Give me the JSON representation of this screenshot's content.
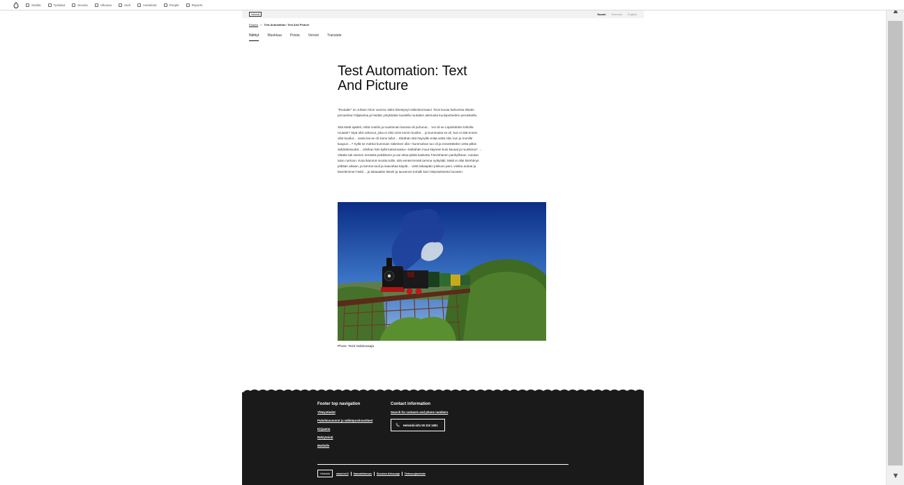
{
  "toolbar": {
    "items": [
      {
        "label": "Sisältö",
        "icon": "content-icon"
      },
      {
        "label": "Työkalut",
        "icon": "tools-icon"
      },
      {
        "label": "Sivusto",
        "icon": "site-icon"
      },
      {
        "label": "Ulkoasu",
        "icon": "appearance-icon"
      },
      {
        "label": "Kieli",
        "icon": "language-icon"
      },
      {
        "label": "Asetukset",
        "icon": "settings-icon"
      },
      {
        "label": "People",
        "icon": "people-icon"
      },
      {
        "label": "Reports",
        "icon": "reports-icon"
      }
    ]
  },
  "header": {
    "logo": "Helsinki",
    "languages": [
      "Suomi",
      "Svenska",
      "English"
    ]
  },
  "breadcrumb": {
    "home": "Etusivu",
    "separator": ">",
    "current": "Test Automation: Text And Picture"
  },
  "nav": [
    "Nähtyt",
    "Muokkaa",
    "Poista",
    "Versiot",
    "Translate"
  ],
  "article": {
    "title": "Test Automation: Text And Picture",
    "paragraphs": [
      "\"Routatie\" on Juhani Ahon vuonna 1884 ilmestynyt esikoisromaani. Teos kuvaa kahvessa elävän porvariston hiljaiseloa ja heidän yrityksiään kuvitella routatien alemusta kuulopuheiden perusteella.",
      "Sitä Matti ajatteli, mittä routtiin ja ruustinnan kanssa oli puhunut… Voi oli se Lapinlahden kirkolla routatie? Sipä olisi uskonut, joka ei olisi omin korvin kuullut… ja kummasta se oli, kun ei sitä ennen ollut kuullut… vasta kai se oli sinne tullut… Eikähän sitä häyryille enää vettä nitä, kun ja monille kaupun…? Kyllä se mahtoi kummain näköinen olla—kummahan tuo oli ja ennesttänkin vettä pitkin sähäöttesuuttä… olisihan hän kyllä katsomassa—kiekähän muut käyneet kuin kavuat ja ruustinna? …Vittatie tali niemen nenästä poikkikeen ja sai ottoa pitkät kaskotta Tärvinhanen parikylikean, nutulan taion nortoon. Kuta ikämmä mootta tullin, sitä venterrmmäti tamma nytkyttäli. Matti ei ollut kiirehtinyt pitkään aikaan, ja tamma tuuli ja saavuttaa käydä… vielä takaapäin jukkuvo pani, voikka autoat ja käveleminen heitti… ja takaaatkin käveli ja tauramon kohalli kuin helpotukseeta huooten."
    ],
    "caption": "Photo: Testi Valokuvaaja"
  },
  "footer": {
    "nav_title": "Footer top navigation",
    "nav_links": [
      "Yhteystiedot",
      "Puhelinnumerot ja sähköpostiosoitteet",
      "Kirjaamo",
      "Rekrytointi",
      "Mediolle"
    ],
    "contact_title": "Contact information",
    "contact_link": "Search for contacts and phone numbers",
    "phone_label": "Helsinki-info 09 310 1691",
    "logo": "Helsinki",
    "bottom_links": [
      "www.hel.fi",
      "Saavutettavuus",
      "Sivuston tietosuoja",
      "Tietosuojaseloste"
    ]
  },
  "colors": {
    "footer_bg": "#1a1a1a",
    "accent": "#111111",
    "scrollbar_thumb": "#c1c1c1"
  }
}
